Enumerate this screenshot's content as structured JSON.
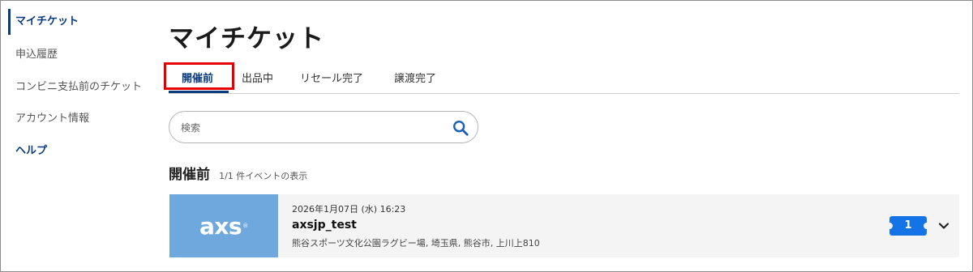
{
  "sidebar": {
    "items": [
      {
        "label": "マイチケット"
      },
      {
        "label": "申込履歴"
      },
      {
        "label": "コンビニ支払前のチケット"
      },
      {
        "label": "アカウント情報"
      },
      {
        "label": "ヘルプ"
      }
    ]
  },
  "main": {
    "title": "マイチケット",
    "tabs": [
      {
        "label": "開催前"
      },
      {
        "label": "出品中"
      },
      {
        "label": "リセール完了"
      },
      {
        "label": "譲渡完了"
      }
    ],
    "search": {
      "placeholder": "検索",
      "icon": "search-icon"
    },
    "section": {
      "title": "開催前",
      "subtitle": "1/1 件イベントの表示"
    },
    "events": [
      {
        "logo_text": "axs",
        "logo_mark": "®",
        "datetime": "2026年1月07日 (水) 16:23",
        "name": "axsjp_test",
        "venue": "熊谷スポーツ文化公園ラグビー場, 埼玉県, 熊谷市, 上川上810",
        "ticket_count": "1"
      }
    ]
  },
  "colors": {
    "accent": "#0a3b7d",
    "highlight": "#e60000",
    "ticket_badge": "#1473e6",
    "logo_bg": "#6fa8dc"
  }
}
